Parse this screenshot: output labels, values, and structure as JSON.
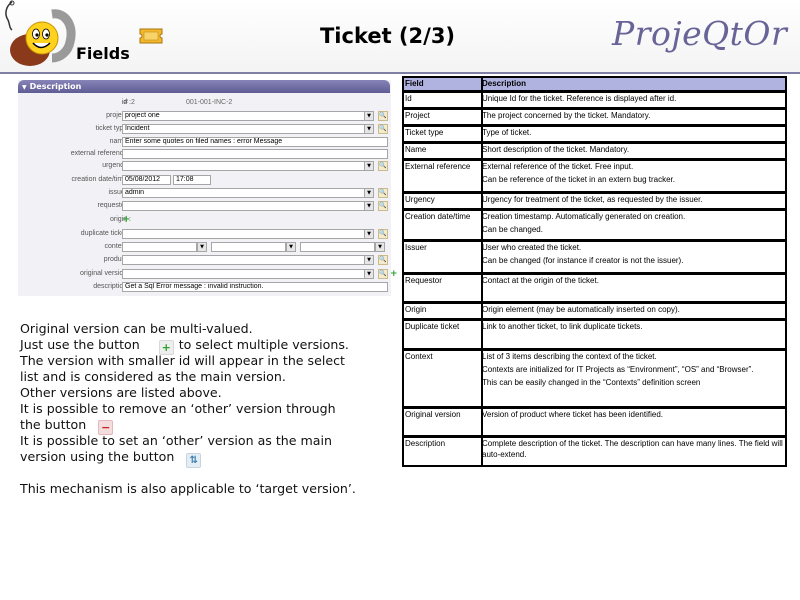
{
  "header": {
    "fields_label": "Fields",
    "title": "Ticket (2/3)",
    "brand": "ProjeQtOr"
  },
  "form": {
    "section_title": "Description",
    "fields": {
      "id": {
        "label": "id :",
        "hash": "#",
        "value": "2",
        "reference": "001-001-INC-2"
      },
      "project": {
        "label": "project :",
        "value": "project one"
      },
      "ticket_type": {
        "label": "ticket type :",
        "value": "Incident"
      },
      "name": {
        "label": "name :",
        "value": "Enter some quotes on filed names : error Message"
      },
      "external_reference": {
        "label": "external reference :",
        "value": ""
      },
      "urgency": {
        "label": "urgency :",
        "value": ""
      },
      "creation_datetime": {
        "label": "creation date/time :",
        "date": "05/08/2012",
        "time": "17:08"
      },
      "issuer": {
        "label": "issuer :",
        "value": "admin"
      },
      "requestor": {
        "label": "requestor :",
        "value": ""
      },
      "origin": {
        "label": "origin :"
      },
      "duplicate_ticket": {
        "label": "duplicate ticket :",
        "value": ""
      },
      "context": {
        "label": "context :"
      },
      "product": {
        "label": "product :",
        "value": ""
      },
      "original_version": {
        "label": "original version :",
        "value": ""
      },
      "description": {
        "label": "description :",
        "value": "Get a Sql Error message : invalid instruction."
      }
    }
  },
  "explanation": {
    "line1": "Original version can be multi-valued.",
    "line2_pre": "Just use the button",
    "line2_post": "to select multiple versions.",
    "line3": "The version with smaller id will appear in the select",
    "line4": "list and is considered as the main version.",
    "line5": "Other versions are listed above.",
    "line6": "It is possible to remove an ‘other’ version through",
    "line7": "the button",
    "line8": "It is possible to set an ‘other’ version as the main",
    "line9": "version using the button",
    "line10": "This mechanism is also applicable to ‘target version’."
  },
  "table": {
    "header": {
      "field": "Field",
      "description": "Description"
    },
    "rows": [
      {
        "field": "Id",
        "lines": [
          "Unique Id for the ticket.  Reference is displayed after id."
        ]
      },
      {
        "field": "Project",
        "lines": [
          "The project concerned by the ticket. Mandatory."
        ]
      },
      {
        "field": "Ticket type",
        "lines": [
          "Type of ticket."
        ]
      },
      {
        "field": "Name",
        "lines": [
          "Short description of the ticket. Mandatory."
        ]
      },
      {
        "field": "External reference",
        "lines": [
          "External reference of the ticket. Free input.",
          "Can be reference of the ticket in an extern bug tracker."
        ]
      },
      {
        "field": "Urgency",
        "lines": [
          "Urgency for treatment of the ticket, as requested by the issuer."
        ]
      },
      {
        "field": "Creation date/time",
        "lines": [
          "Creation timestamp. Automatically generated on creation.",
          "Can be changed."
        ]
      },
      {
        "field": "Issuer",
        "lines": [
          "User who created the ticket.",
          "Can be changed (for instance if creator is not the issuer)."
        ]
      },
      {
        "field": "Requestor",
        "lines": [
          "Contact at the origin of the ticket."
        ]
      },
      {
        "field": "Origin",
        "lines": [
          "Origin element (may be automatically inserted on copy)."
        ]
      },
      {
        "field": "Duplicate ticket",
        "lines": [
          "Link to another ticket, to link duplicate tickets."
        ]
      },
      {
        "field": "Context",
        "lines": [
          "List of 3 items describing the context of the ticket.",
          "Contexts are initialized for IT Projects as “Environment”, “OS” and “Browser”.",
          "This can be easily changed in the “Contexts” definition screen"
        ]
      },
      {
        "field": "Original version",
        "lines": [
          "Version of product where ticket has been identified."
        ]
      },
      {
        "field": "Description",
        "lines": [
          "Complete description of the ticket. The description can have many lines. The field will auto-extend."
        ]
      }
    ]
  }
}
